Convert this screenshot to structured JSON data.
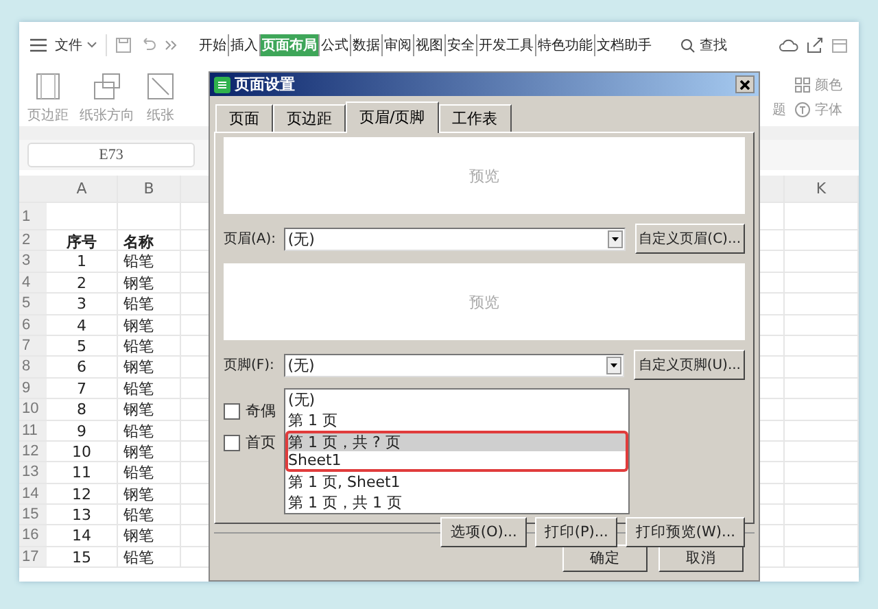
{
  "menu_bar": {
    "file_menu": "文件",
    "tabs": [
      {
        "label": "开始",
        "selected": false
      },
      {
        "label": "插入",
        "selected": false
      },
      {
        "label": "页面布局",
        "selected": true
      },
      {
        "label": "公式",
        "selected": false
      },
      {
        "label": "数据",
        "selected": false
      },
      {
        "label": "审阅",
        "selected": false
      },
      {
        "label": "视图",
        "selected": false
      },
      {
        "label": "安全",
        "selected": false
      },
      {
        "label": "开发工具",
        "selected": false
      },
      {
        "label": "特色功能",
        "selected": false
      },
      {
        "label": "文档助手",
        "selected": false
      }
    ],
    "search": "查找"
  },
  "ribbon": {
    "left_items": [
      {
        "label": "页边距",
        "kind": "margin"
      },
      {
        "label": "纸张方向",
        "kind": "orientation"
      },
      {
        "label": "纸张",
        "kind": "size"
      }
    ],
    "right_items": [
      {
        "label": "题",
        "kind": "theme"
      },
      {
        "label": "颜色",
        "kind": "color"
      },
      {
        "label": "字体",
        "kind": "font"
      }
    ]
  },
  "name_box": "E73",
  "sheet": {
    "columns": [
      "A",
      "B"
    ],
    "right_column": "K",
    "rows": [
      {
        "number": "1",
        "kind": "empty"
      },
      {
        "number": "2",
        "kind": "header",
        "cells": [
          "序号",
          "名称"
        ]
      },
      {
        "number": "3",
        "kind": "data",
        "cells": [
          "1",
          "铅笔"
        ]
      },
      {
        "number": "4",
        "kind": "data",
        "cells": [
          "2",
          "钢笔"
        ]
      },
      {
        "number": "5",
        "kind": "data",
        "cells": [
          "3",
          "铅笔"
        ]
      },
      {
        "number": "6",
        "kind": "data",
        "cells": [
          "4",
          "钢笔"
        ]
      },
      {
        "number": "7",
        "kind": "data",
        "cells": [
          "5",
          "铅笔"
        ]
      },
      {
        "number": "8",
        "kind": "data",
        "cells": [
          "6",
          "钢笔"
        ]
      },
      {
        "number": "9",
        "kind": "data",
        "cells": [
          "7",
          "铅笔"
        ]
      },
      {
        "number": "10",
        "kind": "data",
        "cells": [
          "8",
          "钢笔"
        ]
      },
      {
        "number": "11",
        "kind": "data",
        "cells": [
          "9",
          "铅笔"
        ]
      },
      {
        "number": "12",
        "kind": "data",
        "cells": [
          "10",
          "钢笔"
        ]
      },
      {
        "number": "13",
        "kind": "data",
        "cells": [
          "11",
          "铅笔"
        ]
      },
      {
        "number": "14",
        "kind": "data",
        "cells": [
          "12",
          "钢笔"
        ]
      },
      {
        "number": "15",
        "kind": "data",
        "cells": [
          "13",
          "铅笔"
        ]
      },
      {
        "number": "16",
        "kind": "data",
        "cells": [
          "14",
          "钢笔"
        ]
      },
      {
        "number": "17",
        "kind": "data",
        "cells": [
          "15",
          "铅笔"
        ]
      }
    ]
  },
  "dialog": {
    "title": "页面设置",
    "tabs": [
      {
        "label": "页面",
        "selected": false
      },
      {
        "label": "页边距",
        "selected": false
      },
      {
        "label": "页眉/页脚",
        "selected": true
      },
      {
        "label": "工作表",
        "selected": false
      }
    ],
    "header_preview": "预览",
    "header_label": "页眉(A):",
    "header_value": "(无)",
    "header_button": "自定义页眉(C)...",
    "footer_preview": "预览",
    "footer_label": "页脚(F):",
    "footer_value": "(无)",
    "footer_button": "自定义页脚(U)...",
    "footer_options": [
      {
        "label": "(无)",
        "selected": false,
        "outlined": false
      },
      {
        "label": "第 1 页",
        "selected": false,
        "outlined": false
      },
      {
        "label": "第 1 页，共 ? 页",
        "selected": true,
        "outlined": true
      },
      {
        "label": "Sheet1",
        "selected": false,
        "outlined": true
      },
      {
        "label": "第 1 页, Sheet1",
        "selected": false,
        "outlined": false
      },
      {
        "label": "第 1 页，共 1 页",
        "selected": false,
        "outlined": false
      }
    ],
    "checkboxes": [
      {
        "label": "奇偶",
        "checked": false
      },
      {
        "label": "首页",
        "checked": false
      }
    ],
    "action_buttons": [
      "选项(O)...",
      "打印(P)...",
      "打印预览(W)..."
    ],
    "ok": "确定",
    "cancel": "取消"
  }
}
